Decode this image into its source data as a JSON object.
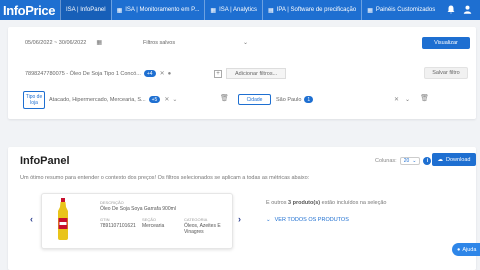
{
  "app": {
    "logo": "InfoPrice"
  },
  "nav": {
    "tabs": [
      {
        "label": "ISA | InfoPanel",
        "active": true
      },
      {
        "label": "ISA | Monitoramento em P...",
        "active": false
      },
      {
        "label": "ISA | Analytics",
        "active": false
      },
      {
        "label": "IPA | Software de precificação",
        "active": false
      },
      {
        "label": "Painéis Customizados",
        "active": false
      }
    ],
    "right_icons": [
      "bell-icon",
      "user-icon"
    ]
  },
  "filters": {
    "date_range": "05/06/2022 ~ 30/06/2022",
    "saved_filters_placeholder": "Filtros salvos",
    "apply_label": "Visualizar",
    "product": "7898247780075 - Óleo De Soja Tipo 1 Concó...",
    "product_count": "+4",
    "add_filter_label": "Adicionar filtros...",
    "save_filter_label": "Salvar filtro",
    "store_type_chip": "Tipo de loja",
    "store_type_value": "Atacado, Hipermercado, Mercearia, S...",
    "store_type_count": "+5",
    "city_chip": "Cidade",
    "city_value": "São Paulo",
    "city_count": "1"
  },
  "panel": {
    "title": "InfoPanel",
    "description": "Um ótimo resumo para entender o contexto dos preços! Os filtros selecionados se aplicam a todas as métricas abaixo:",
    "columns_label": "Colunas:",
    "columns_value": "20",
    "download_label": "Download",
    "product_card": {
      "desc_label": "DESCRIÇÃO",
      "desc_value": "Óleo De Soja Soya Garrafa 900ml",
      "gtin_label": "GTIN",
      "gtin_value": "7891107101621",
      "section_label": "SEÇÃO",
      "section_value": "Mercearia",
      "category_label": "CATEGORIA",
      "category_value": "Óleos, Azeites E Vinagres"
    },
    "more_text_prefix": "E outros",
    "more_text_bold": "3 produto(s)",
    "more_text_suffix": "estão incluídos na seleção",
    "see_all_label": "VER TODOS OS PRODUTOS"
  },
  "help": {
    "label": "Ajuda"
  },
  "colors": {
    "primary": "#1e6fd1",
    "background": "#f1f3f6"
  }
}
